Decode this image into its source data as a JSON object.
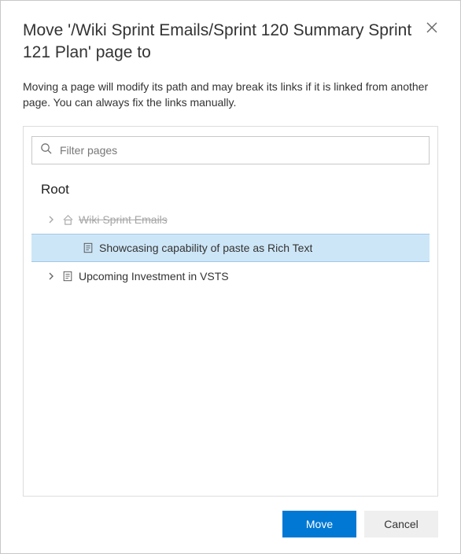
{
  "dialog": {
    "title": "Move '/Wiki Sprint Emails/Sprint 120 Summary Sprint 121 Plan' page to",
    "description": "Moving a page will modify its path and may break its links if it is linked from another page. You can always fix the links manually."
  },
  "filter": {
    "placeholder": "Filter pages",
    "value": ""
  },
  "tree": {
    "root_label": "Root",
    "nodes": [
      {
        "label": "Wiki Sprint Emails",
        "icon": "home-icon",
        "expandable": true,
        "level": 1,
        "disabled": true,
        "selected": false
      },
      {
        "label": "Showcasing capability of paste as Rich Text",
        "icon": "page-icon",
        "expandable": false,
        "level": 2,
        "disabled": false,
        "selected": true
      },
      {
        "label": "Upcoming Investment in VSTS",
        "icon": "page-icon",
        "expandable": true,
        "level": 1,
        "disabled": false,
        "selected": false
      }
    ]
  },
  "footer": {
    "primary": "Move",
    "secondary": "Cancel"
  },
  "icons": {
    "close": "close-icon",
    "search": "search-icon",
    "chevron": "chevron-right-icon"
  }
}
